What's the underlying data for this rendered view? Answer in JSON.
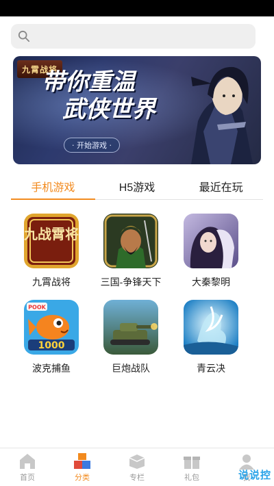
{
  "search": {
    "placeholder": ""
  },
  "banner": {
    "logo_text": "九霄战将",
    "headline_line1": "带你重温",
    "headline_line2": "武侠世界",
    "button_label": "· 开始游戏 ·"
  },
  "tabs": [
    {
      "label": "手机游戏",
      "active": true
    },
    {
      "label": "H5游戏",
      "active": false
    },
    {
      "label": "最近在玩",
      "active": false
    }
  ],
  "games": [
    {
      "name": "九霄战将",
      "icon": "jiuxiao-zhanjiang-icon"
    },
    {
      "name": "三国-争锋天下",
      "icon": "sanguo-zhengfeng-icon"
    },
    {
      "name": "大秦黎明",
      "icon": "daqin-liming-icon"
    },
    {
      "name": "波克捕鱼",
      "icon": "boke-buyu-icon"
    },
    {
      "name": "巨炮战队",
      "icon": "jupao-zhandui-icon"
    },
    {
      "name": "青云决",
      "icon": "qingyunjue-icon"
    }
  ],
  "icon_text": {
    "jiuxiao": "九战霄将",
    "pook": "POOK",
    "score": "1000"
  },
  "nav": [
    {
      "label": "首页",
      "icon": "home-icon",
      "active": false
    },
    {
      "label": "分类",
      "icon": "category-cubes-icon",
      "active": true
    },
    {
      "label": "专栏",
      "icon": "column-icon",
      "active": false
    },
    {
      "label": "礼包",
      "icon": "gift-icon",
      "active": false
    },
    {
      "label": "我",
      "icon": "profile-icon",
      "active": false
    }
  ],
  "watermark": "说说控",
  "colors": {
    "accent": "#f28a1e",
    "inactive": "#9a9a9a",
    "watermark": "#2aa3e8"
  }
}
